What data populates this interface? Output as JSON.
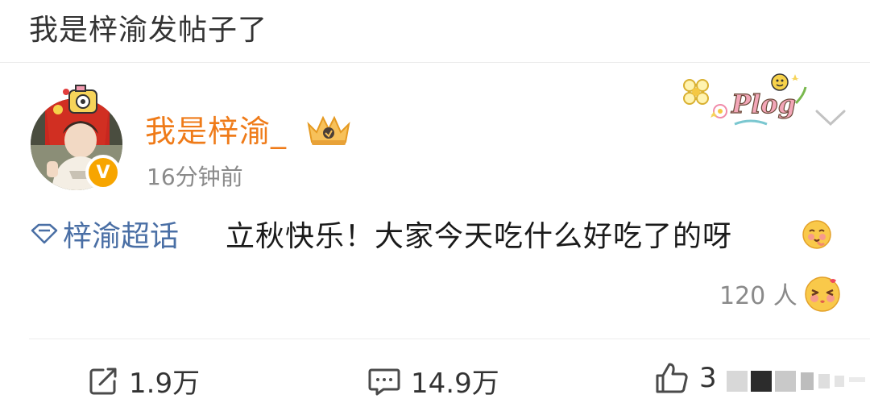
{
  "header": {
    "title": "我是梓渝发帖子了"
  },
  "post": {
    "username": "我是梓渝_",
    "time": "16分钟前",
    "sticker_text": "Plog",
    "topic": "梓渝超话",
    "text": "立秋快乐！大家今天吃什么好吃了的呀",
    "verified_mark": "V",
    "reactions": "120 人"
  },
  "actions": {
    "repost_count": "1.9万",
    "comment_count": "14.9万",
    "like_count": "3"
  },
  "colors": {
    "username": "#ef7b19",
    "topic": "#4a6fa5",
    "badge": "#f7a500"
  }
}
